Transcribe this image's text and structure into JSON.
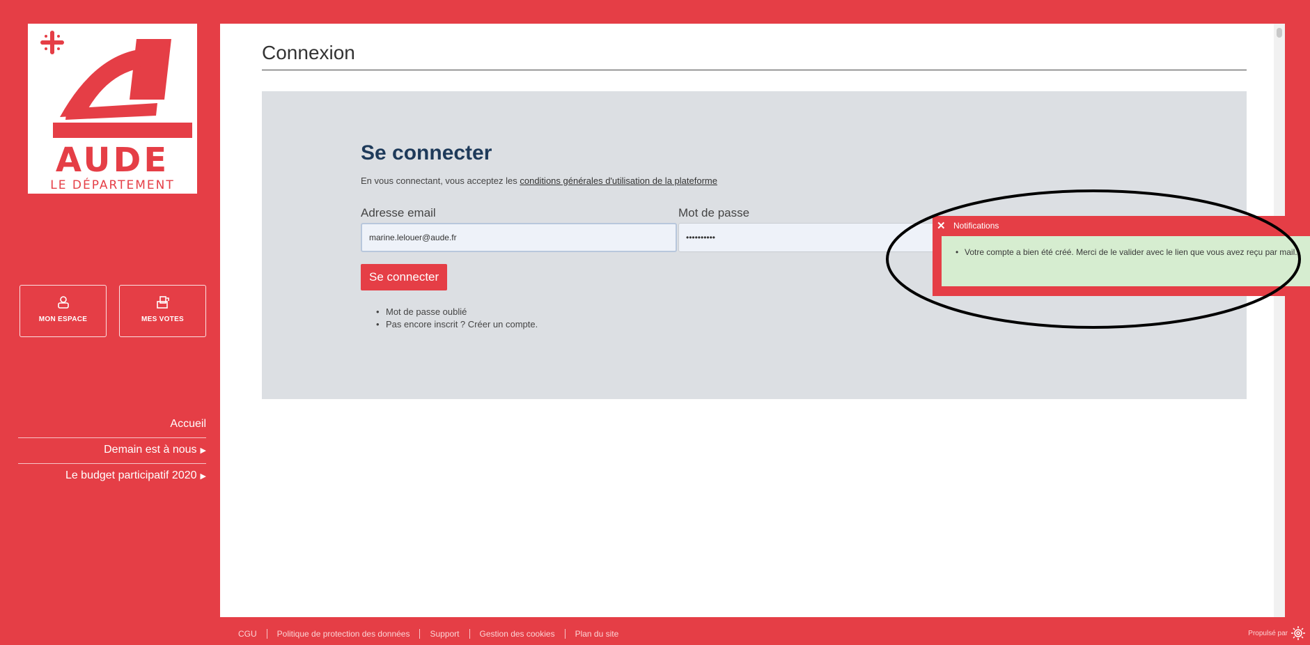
{
  "sidebar": {
    "logo": {
      "brand": "AUDE",
      "subtitle": "LE DÉPARTEMENT"
    },
    "buttons": {
      "espace": "MON ESPACE",
      "votes": "MES VOTES"
    },
    "nav": [
      {
        "label": "Accueil"
      },
      {
        "label": "Demain est à nous"
      },
      {
        "label": "Le budget participatif 2020"
      }
    ]
  },
  "main": {
    "title": "Connexion",
    "login": {
      "heading": "Se connecter",
      "terms_prefix": "En vous connectant, vous acceptez les ",
      "terms_link": "conditions générales d'utilisation de la plateforme",
      "email_label": "Adresse email",
      "email_value": "marine.lelouer@aude.fr",
      "password_label": "Mot de passe",
      "password_value": "••••••••••",
      "submit_label": "Se connecter",
      "links": [
        "Mot de passe oublié",
        "Pas encore inscrit ? Créer un compte."
      ]
    }
  },
  "notification": {
    "close": "✕",
    "title": "Notifications",
    "message": "Votre compte a bien été créé. Merci de le valider avec le lien que vous avez reçu par mail."
  },
  "footer": {
    "links": [
      "CGU",
      "Politique de protection des données",
      "Support",
      "Gestion des cookies",
      "Plan du site"
    ],
    "powered_by": "Propulsé par"
  },
  "colors": {
    "brand": "#e53e46",
    "panel": "#dcdfe3",
    "heading": "#1e3a5a",
    "success": "#d6edd0"
  }
}
